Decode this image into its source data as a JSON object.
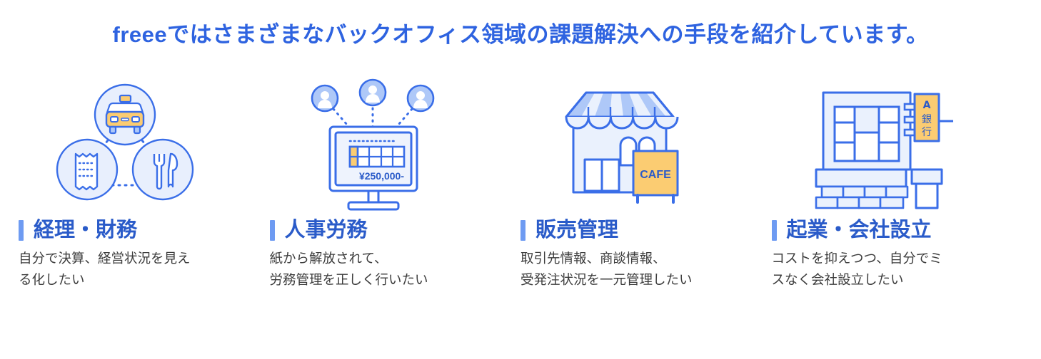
{
  "header": {
    "title": "freeeではさまざまなバックオフィス領域の課題解決への手段を紹介しています。",
    "title_color": "#2e63e0"
  },
  "theme": {
    "accent_bar_color": "#6e9bf2",
    "heading_color": "#2a5bc9",
    "body_text_color": "#3c3c3c",
    "icon_stroke": "#3a6ee8",
    "icon_fill_light": "#e8effd",
    "icon_fill_mid": "#aec8f8",
    "icon_accent_yellow": "#fbcc72",
    "background": "#ffffff"
  },
  "cards": [
    {
      "icon": "accounting-finance-icon",
      "icon_parts": [
        "taxi-icon",
        "receipt-icon",
        "cutlery-icon"
      ],
      "title": "経理・財務",
      "body_lines": [
        "自分で決算、経営状況を見え",
        "る化したい"
      ]
    },
    {
      "icon": "hr-labor-icon",
      "icon_parts": [
        "monitor-icon",
        "person-avatar-icon",
        "spreadsheet-icon"
      ],
      "icon_label": "¥250,000-",
      "title": "人事労務",
      "body_lines": [
        "紙から解放されて、",
        "労務管理を正しく行いたい"
      ]
    },
    {
      "icon": "sales-management-icon",
      "icon_parts": [
        "storefront-icon",
        "awning-icon",
        "sandwich-board-icon"
      ],
      "icon_label": "CAFE",
      "title": "販売管理",
      "body_lines": [
        "取引先情報、商談情報、",
        "受発注状況を一元管理したい"
      ]
    },
    {
      "icon": "company-establishment-icon",
      "icon_parts": [
        "bank-building-icon",
        "vertical-sign-icon"
      ],
      "icon_label": "A銀行",
      "icon_label_chars": [
        "A",
        "銀",
        "行"
      ],
      "title": "起業・会社設立",
      "body_lines": [
        "コストを抑えつつ、自分でミ",
        "スなく会社設立したい"
      ]
    }
  ]
}
